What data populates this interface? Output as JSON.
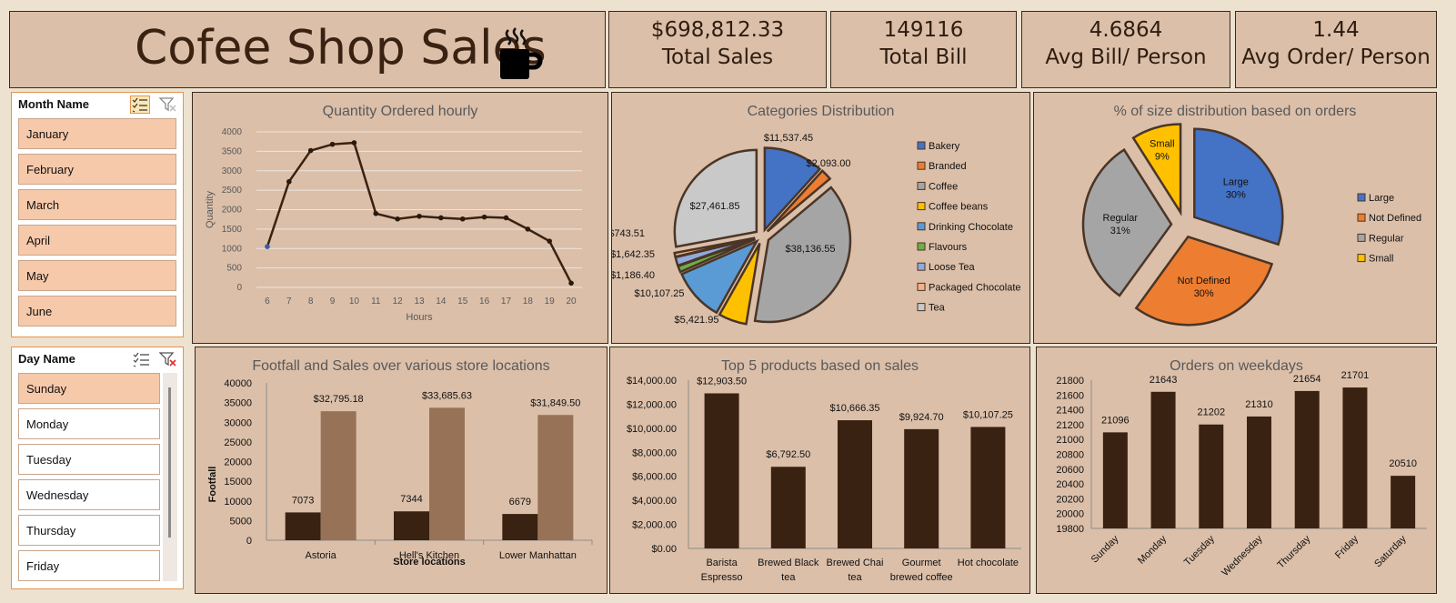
{
  "header": {
    "title": "Cofee Shop Sales",
    "icon": "coffee-cup-icon"
  },
  "kpis": [
    {
      "value": "$698,812.33",
      "label": "Total Sales"
    },
    {
      "value": "149116",
      "label": "Total Bill"
    },
    {
      "value": "4.6864",
      "label": "Avg Bill/ Person"
    },
    {
      "value": "1.44",
      "label": "Avg Order/ Person"
    }
  ],
  "month_slicer": {
    "title": "Month Name",
    "items": [
      "January",
      "February",
      "March",
      "April",
      "May",
      "June"
    ],
    "selected": [
      "January",
      "February",
      "March",
      "April",
      "May",
      "June"
    ]
  },
  "day_slicer": {
    "title": "Day Name",
    "items": [
      "Sunday",
      "Monday",
      "Tuesday",
      "Wednesday",
      "Thursday",
      "Friday"
    ],
    "selected": [
      "Sunday"
    ]
  },
  "colors": {
    "dark_brown": "#3a2212",
    "light_brown": "#977257",
    "panel": "#dbbfa9",
    "slicer_selected": "#f6c9aa"
  },
  "chart_data": [
    {
      "type": "line",
      "title": "Quantity Ordered hourly",
      "xlabel": "Hours",
      "ylabel": "Quantity",
      "x": [
        6,
        7,
        8,
        9,
        10,
        11,
        12,
        13,
        14,
        15,
        16,
        17,
        18,
        19,
        20
      ],
      "values": [
        1050,
        2720,
        3520,
        3680,
        3720,
        1900,
        1760,
        1830,
        1790,
        1760,
        1810,
        1790,
        1500,
        1190,
        110
      ],
      "ylim": [
        0,
        4000
      ],
      "yticks": [
        "0",
        "500",
        "1000",
        "1500",
        "2000",
        "2500",
        "3000",
        "3500",
        "4000"
      ],
      "grid": true
    },
    {
      "type": "pie",
      "title": "Categories Distribution",
      "categories": [
        "Bakery",
        "Branded",
        "Coffee",
        "Coffee beans",
        "Drinking Chocolate",
        "Flavours",
        "Loose Tea",
        "Packaged Chocolate",
        "Tea"
      ],
      "values": [
        11537.45,
        2093.0,
        38136.55,
        5421.95,
        10107.25,
        1186.4,
        1642.35,
        743.51,
        27461.85
      ],
      "labels": [
        "$11,537.45",
        "$2,093.00",
        "$38,136.55",
        "$5,421.95",
        "$10,107.25",
        "$1,186.40",
        "$1,642.35",
        "$743.51",
        "$27,461.85"
      ],
      "colors": [
        "#4472c4",
        "#ed7d31",
        "#a5a5a5",
        "#ffc000",
        "#5b9bd5",
        "#70ad47",
        "#8faadc",
        "#f4b183",
        "#c9c9c9"
      ],
      "legend": "right"
    },
    {
      "type": "pie",
      "title": "% of size distribution based on orders",
      "categories": [
        "Large",
        "Not Defined",
        "Regular",
        "Small"
      ],
      "values": [
        30,
        30,
        31,
        9
      ],
      "labels": [
        "30%",
        "30%",
        "31%",
        "9%"
      ],
      "colors": [
        "#4472c4",
        "#ed7d31",
        "#a5a5a5",
        "#ffc000"
      ],
      "legend": "right"
    },
    {
      "type": "bar",
      "title": "Footfall and Sales over various store locations",
      "categories": [
        "Astoria",
        "Hell's Kitchen",
        "Lower Manhattan"
      ],
      "series": [
        {
          "values": [
            7073,
            7344,
            6679
          ],
          "labels": [
            "7073",
            "7344",
            "6679"
          ]
        },
        {
          "values": [
            32795.18,
            33685.63,
            31849.5
          ],
          "labels": [
            "$32,795.18",
            "$33,685.63",
            "$31,849.50"
          ]
        }
      ],
      "xlabel": "Store locations",
      "ylabel": "Footfall",
      "ylim": [
        0,
        40000
      ],
      "yticks": [
        "0",
        "5000",
        "10000",
        "15000",
        "20000",
        "25000",
        "30000",
        "35000",
        "40000"
      ]
    },
    {
      "type": "bar",
      "title": "Top 5 products based on sales",
      "categories": [
        [
          "Barista",
          "Espresso"
        ],
        [
          "Brewed Black",
          "tea"
        ],
        [
          "Brewed Chai",
          "tea"
        ],
        [
          "Gourmet",
          "brewed coffee"
        ],
        [
          "Hot chocolate"
        ]
      ],
      "values": [
        12903.5,
        6792.5,
        10666.35,
        9924.7,
        10107.25
      ],
      "labels": [
        "$12,903.50",
        "$6,792.50",
        "$10,666.35",
        "$9,924.70",
        "$10,107.25"
      ],
      "ylim": [
        0,
        14000
      ],
      "yticks": [
        "$0.00",
        "$2,000.00",
        "$4,000.00",
        "$6,000.00",
        "$8,000.00",
        "$10,000.00",
        "$12,000.00",
        "$14,000.00"
      ]
    },
    {
      "type": "bar",
      "title": "Orders on weekdays",
      "categories": [
        "Sunday",
        "Monday",
        "Tuesday",
        "Wednesday",
        "Thursday",
        "Friday",
        "Saturday"
      ],
      "values": [
        21096,
        21643,
        21202,
        21310,
        21654,
        21701,
        20510
      ],
      "labels": [
        "21096",
        "21643",
        "21202",
        "21310",
        "21654",
        "21701",
        "20510"
      ],
      "ylim": [
        19800,
        21800
      ],
      "yticks": [
        "19800",
        "20000",
        "20200",
        "20400",
        "20600",
        "20800",
        "21000",
        "21200",
        "21400",
        "21600",
        "21800"
      ]
    }
  ]
}
